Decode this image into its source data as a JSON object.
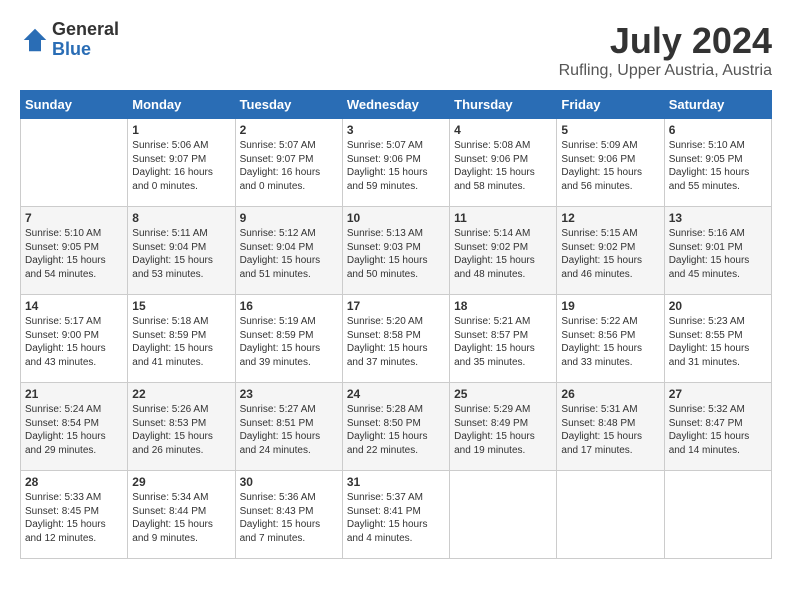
{
  "logo": {
    "general": "General",
    "blue": "Blue"
  },
  "title": "July 2024",
  "location": "Rufling, Upper Austria, Austria",
  "days_of_week": [
    "Sunday",
    "Monday",
    "Tuesday",
    "Wednesday",
    "Thursday",
    "Friday",
    "Saturday"
  ],
  "weeks": [
    [
      {
        "day": "",
        "sunrise": "",
        "sunset": "",
        "daylight": ""
      },
      {
        "day": "1",
        "sunrise": "Sunrise: 5:06 AM",
        "sunset": "Sunset: 9:07 PM",
        "daylight": "Daylight: 16 hours and 0 minutes."
      },
      {
        "day": "2",
        "sunrise": "Sunrise: 5:07 AM",
        "sunset": "Sunset: 9:07 PM",
        "daylight": "Daylight: 16 hours and 0 minutes."
      },
      {
        "day": "3",
        "sunrise": "Sunrise: 5:07 AM",
        "sunset": "Sunset: 9:06 PM",
        "daylight": "Daylight: 15 hours and 59 minutes."
      },
      {
        "day": "4",
        "sunrise": "Sunrise: 5:08 AM",
        "sunset": "Sunset: 9:06 PM",
        "daylight": "Daylight: 15 hours and 58 minutes."
      },
      {
        "day": "5",
        "sunrise": "Sunrise: 5:09 AM",
        "sunset": "Sunset: 9:06 PM",
        "daylight": "Daylight: 15 hours and 56 minutes."
      },
      {
        "day": "6",
        "sunrise": "Sunrise: 5:10 AM",
        "sunset": "Sunset: 9:05 PM",
        "daylight": "Daylight: 15 hours and 55 minutes."
      }
    ],
    [
      {
        "day": "7",
        "sunrise": "Sunrise: 5:10 AM",
        "sunset": "Sunset: 9:05 PM",
        "daylight": "Daylight: 15 hours and 54 minutes."
      },
      {
        "day": "8",
        "sunrise": "Sunrise: 5:11 AM",
        "sunset": "Sunset: 9:04 PM",
        "daylight": "Daylight: 15 hours and 53 minutes."
      },
      {
        "day": "9",
        "sunrise": "Sunrise: 5:12 AM",
        "sunset": "Sunset: 9:04 PM",
        "daylight": "Daylight: 15 hours and 51 minutes."
      },
      {
        "day": "10",
        "sunrise": "Sunrise: 5:13 AM",
        "sunset": "Sunset: 9:03 PM",
        "daylight": "Daylight: 15 hours and 50 minutes."
      },
      {
        "day": "11",
        "sunrise": "Sunrise: 5:14 AM",
        "sunset": "Sunset: 9:02 PM",
        "daylight": "Daylight: 15 hours and 48 minutes."
      },
      {
        "day": "12",
        "sunrise": "Sunrise: 5:15 AM",
        "sunset": "Sunset: 9:02 PM",
        "daylight": "Daylight: 15 hours and 46 minutes."
      },
      {
        "day": "13",
        "sunrise": "Sunrise: 5:16 AM",
        "sunset": "Sunset: 9:01 PM",
        "daylight": "Daylight: 15 hours and 45 minutes."
      }
    ],
    [
      {
        "day": "14",
        "sunrise": "Sunrise: 5:17 AM",
        "sunset": "Sunset: 9:00 PM",
        "daylight": "Daylight: 15 hours and 43 minutes."
      },
      {
        "day": "15",
        "sunrise": "Sunrise: 5:18 AM",
        "sunset": "Sunset: 8:59 PM",
        "daylight": "Daylight: 15 hours and 41 minutes."
      },
      {
        "day": "16",
        "sunrise": "Sunrise: 5:19 AM",
        "sunset": "Sunset: 8:59 PM",
        "daylight": "Daylight: 15 hours and 39 minutes."
      },
      {
        "day": "17",
        "sunrise": "Sunrise: 5:20 AM",
        "sunset": "Sunset: 8:58 PM",
        "daylight": "Daylight: 15 hours and 37 minutes."
      },
      {
        "day": "18",
        "sunrise": "Sunrise: 5:21 AM",
        "sunset": "Sunset: 8:57 PM",
        "daylight": "Daylight: 15 hours and 35 minutes."
      },
      {
        "day": "19",
        "sunrise": "Sunrise: 5:22 AM",
        "sunset": "Sunset: 8:56 PM",
        "daylight": "Daylight: 15 hours and 33 minutes."
      },
      {
        "day": "20",
        "sunrise": "Sunrise: 5:23 AM",
        "sunset": "Sunset: 8:55 PM",
        "daylight": "Daylight: 15 hours and 31 minutes."
      }
    ],
    [
      {
        "day": "21",
        "sunrise": "Sunrise: 5:24 AM",
        "sunset": "Sunset: 8:54 PM",
        "daylight": "Daylight: 15 hours and 29 minutes."
      },
      {
        "day": "22",
        "sunrise": "Sunrise: 5:26 AM",
        "sunset": "Sunset: 8:53 PM",
        "daylight": "Daylight: 15 hours and 26 minutes."
      },
      {
        "day": "23",
        "sunrise": "Sunrise: 5:27 AM",
        "sunset": "Sunset: 8:51 PM",
        "daylight": "Daylight: 15 hours and 24 minutes."
      },
      {
        "day": "24",
        "sunrise": "Sunrise: 5:28 AM",
        "sunset": "Sunset: 8:50 PM",
        "daylight": "Daylight: 15 hours and 22 minutes."
      },
      {
        "day": "25",
        "sunrise": "Sunrise: 5:29 AM",
        "sunset": "Sunset: 8:49 PM",
        "daylight": "Daylight: 15 hours and 19 minutes."
      },
      {
        "day": "26",
        "sunrise": "Sunrise: 5:31 AM",
        "sunset": "Sunset: 8:48 PM",
        "daylight": "Daylight: 15 hours and 17 minutes."
      },
      {
        "day": "27",
        "sunrise": "Sunrise: 5:32 AM",
        "sunset": "Sunset: 8:47 PM",
        "daylight": "Daylight: 15 hours and 14 minutes."
      }
    ],
    [
      {
        "day": "28",
        "sunrise": "Sunrise: 5:33 AM",
        "sunset": "Sunset: 8:45 PM",
        "daylight": "Daylight: 15 hours and 12 minutes."
      },
      {
        "day": "29",
        "sunrise": "Sunrise: 5:34 AM",
        "sunset": "Sunset: 8:44 PM",
        "daylight": "Daylight: 15 hours and 9 minutes."
      },
      {
        "day": "30",
        "sunrise": "Sunrise: 5:36 AM",
        "sunset": "Sunset: 8:43 PM",
        "daylight": "Daylight: 15 hours and 7 minutes."
      },
      {
        "day": "31",
        "sunrise": "Sunrise: 5:37 AM",
        "sunset": "Sunset: 8:41 PM",
        "daylight": "Daylight: 15 hours and 4 minutes."
      },
      {
        "day": "",
        "sunrise": "",
        "sunset": "",
        "daylight": ""
      },
      {
        "day": "",
        "sunrise": "",
        "sunset": "",
        "daylight": ""
      },
      {
        "day": "",
        "sunrise": "",
        "sunset": "",
        "daylight": ""
      }
    ]
  ]
}
